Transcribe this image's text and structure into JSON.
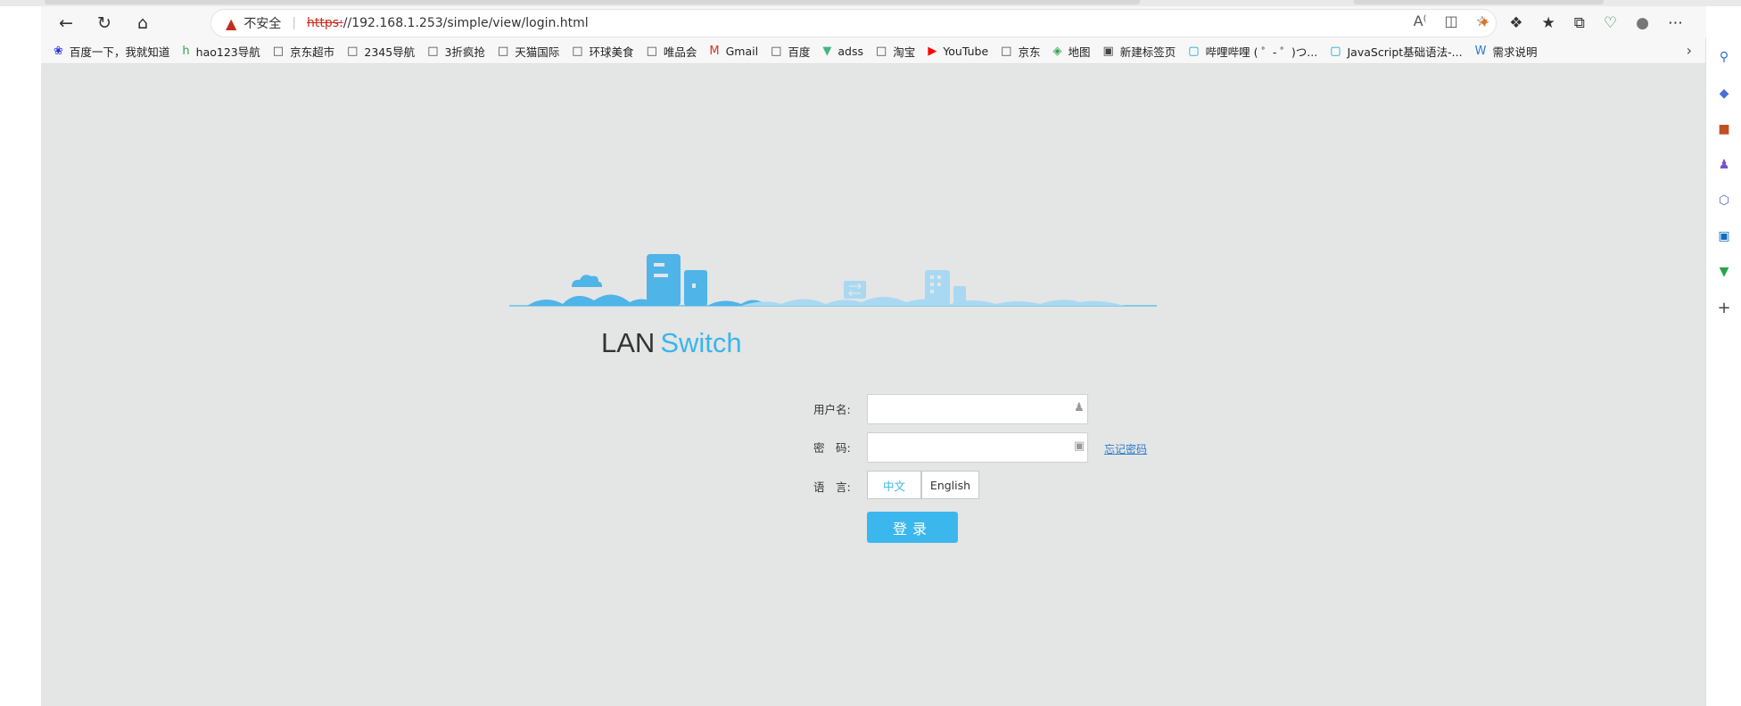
{
  "toolbar": {
    "security_label": "不安全",
    "url_scheme": "https:",
    "url_rest": "//192.168.1.253/simple/view/login.html"
  },
  "bookmarks": [
    {
      "label": "百度一下，我就知道",
      "icon": "paw-icon",
      "color": "#2932e1"
    },
    {
      "label": "hao123导航",
      "icon": "hao-icon",
      "color": "#2fa84f"
    },
    {
      "label": "京东超市",
      "icon": "page-icon",
      "color": "#444444"
    },
    {
      "label": "2345导航",
      "icon": "page-icon",
      "color": "#444444"
    },
    {
      "label": "3折疯抢",
      "icon": "page-icon",
      "color": "#444444"
    },
    {
      "label": "天猫国际",
      "icon": "page-icon",
      "color": "#444444"
    },
    {
      "label": "环球美食",
      "icon": "page-icon",
      "color": "#444444"
    },
    {
      "label": "唯品会",
      "icon": "page-icon",
      "color": "#444444"
    },
    {
      "label": "Gmail",
      "icon": "gmail-icon",
      "color": "#d93025"
    },
    {
      "label": "百度",
      "icon": "page-icon",
      "color": "#444444"
    },
    {
      "label": "adss",
      "icon": "vue-icon",
      "color": "#41b883"
    },
    {
      "label": "淘宝",
      "icon": "page-icon",
      "color": "#444444"
    },
    {
      "label": "YouTube",
      "icon": "youtube-icon",
      "color": "#ff0000"
    },
    {
      "label": "京东",
      "icon": "page-icon",
      "color": "#444444"
    },
    {
      "label": "地图",
      "icon": "map-icon",
      "color": "#34a853"
    },
    {
      "label": "新建标签页",
      "icon": "newtab-icon",
      "color": "#444444"
    },
    {
      "label": "哔哩哔哩 ( ゜- ゜)つ...",
      "icon": "bilibili-icon",
      "color": "#00a1d6"
    },
    {
      "label": "JavaScript基础语法-...",
      "icon": "bilibili-icon",
      "color": "#00a1d6"
    },
    {
      "label": "需求说明",
      "icon": "word-icon",
      "color": "#2b7cd3"
    }
  ],
  "login": {
    "brand_lan": "LAN",
    "brand_switch": "Switch",
    "username_label": "用户名:",
    "password_label": "密　码:",
    "language_label": "语　言:",
    "forgot_link": "忘记密码",
    "lang_zh": "中文",
    "lang_en": "English",
    "login_button": "登录",
    "username_value": "",
    "password_value": ""
  },
  "colors": {
    "accent": "#38b6ed",
    "page_bg": "#e4e5e5",
    "warning": "#c42b1c",
    "link": "#2d7ec9"
  }
}
